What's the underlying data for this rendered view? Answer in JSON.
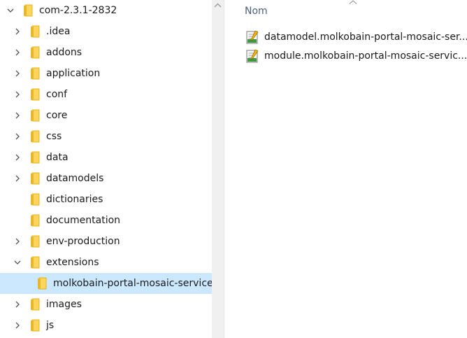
{
  "tree": {
    "root": {
      "label": "com-2.3.1-2832",
      "expanded": true
    },
    "items": [
      {
        "label": ".idea",
        "has_children": true,
        "expanded": false
      },
      {
        "label": "addons",
        "has_children": true,
        "expanded": false
      },
      {
        "label": "application",
        "has_children": true,
        "expanded": false
      },
      {
        "label": "conf",
        "has_children": true,
        "expanded": false
      },
      {
        "label": "core",
        "has_children": true,
        "expanded": false
      },
      {
        "label": "css",
        "has_children": true,
        "expanded": false
      },
      {
        "label": "data",
        "has_children": true,
        "expanded": false
      },
      {
        "label": "datamodels",
        "has_children": true,
        "expanded": false
      },
      {
        "label": "dictionaries",
        "has_children": false,
        "expanded": false
      },
      {
        "label": "documentation",
        "has_children": false,
        "expanded": false
      },
      {
        "label": "env-production",
        "has_children": true,
        "expanded": false
      },
      {
        "label": "extensions",
        "has_children": true,
        "expanded": true
      },
      {
        "label": "molkobain-portal-mosaic-service-",
        "has_children": false,
        "expanded": false,
        "selected": true
      },
      {
        "label": "images",
        "has_children": true,
        "expanded": false
      },
      {
        "label": "js",
        "has_children": true,
        "expanded": false
      }
    ]
  },
  "file_list": {
    "column_name": "Nom",
    "files": [
      {
        "name": "datamodel.molkobain-portal-mosaic-ser...",
        "icon": "php-script-icon"
      },
      {
        "name": "module.molkobain-portal-mosaic-servic...",
        "icon": "php-script-icon"
      }
    ]
  },
  "colors": {
    "selection": "#cce8ff",
    "folder": "#ffd65c",
    "header_text": "#4c607a",
    "text": "#1a1a1a"
  }
}
